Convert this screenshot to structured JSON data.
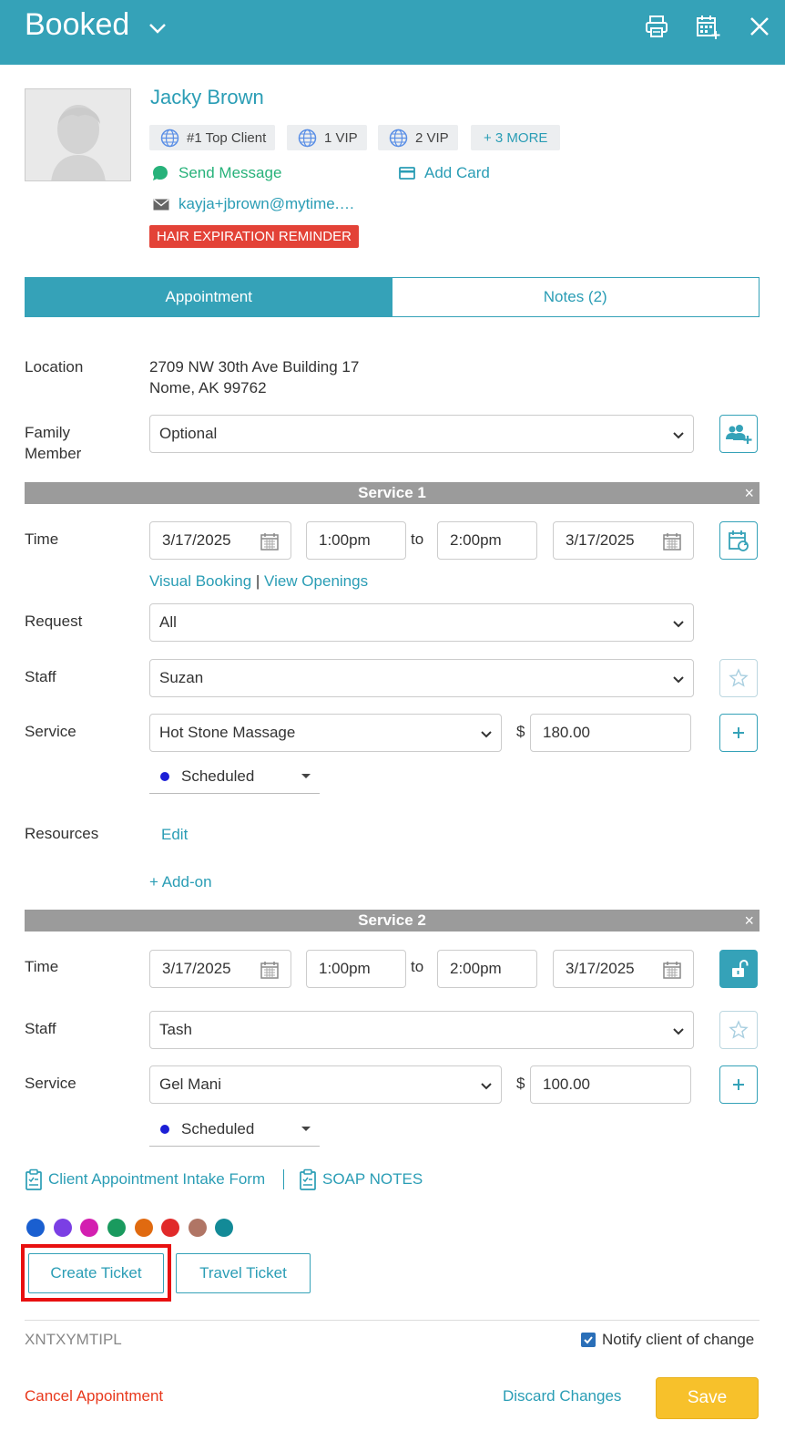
{
  "header": {
    "status_title": "Booked",
    "icons": [
      "print-icon",
      "calendar-add-icon",
      "close-icon"
    ]
  },
  "client": {
    "name": "Jacky Brown",
    "tags": [
      "#1 Top Client",
      "1 VIP",
      "2 VIP"
    ],
    "more_tags": "+ 3 MORE",
    "send_message": "Send Message",
    "add_card": "Add Card",
    "email": "kayja+jbrown@mytime.…",
    "alert": "HAIR EXPIRATION REMINDER"
  },
  "tabs": [
    {
      "label": "Appointment",
      "active": true
    },
    {
      "label": "Notes (2)",
      "active": false
    }
  ],
  "location": {
    "label": "Location",
    "line1": "2709 NW 30th Ave Building 17",
    "line2": "Nome, AK 99762"
  },
  "family_member": {
    "label_line1": "Family",
    "label_line2": "Member",
    "value": "Optional"
  },
  "service1": {
    "header": "Service 1",
    "close": "×",
    "time_label": "Time",
    "start_date": "3/17/2025",
    "start_time": "1:00pm",
    "to": "to",
    "end_time": "2:00pm",
    "end_date": "3/17/2025",
    "visual_booking": "Visual Booking",
    "separator": "|",
    "view_openings": "View Openings",
    "request_label": "Request",
    "request_value": "All",
    "staff_label": "Staff",
    "staff_value": "Suzan",
    "service_label": "Service",
    "service_value": "Hot Stone Massage",
    "currency": "$",
    "price": "180.00",
    "status": "Scheduled",
    "resources_label": "Resources",
    "resources_edit": "Edit",
    "add_on": "+ Add-on"
  },
  "service2": {
    "header": "Service 2",
    "close": "×",
    "time_label": "Time",
    "start_date": "3/17/2025",
    "start_time": "1:00pm",
    "to": "to",
    "end_time": "2:00pm",
    "end_date": "3/17/2025",
    "staff_label": "Staff",
    "staff_value": "Tash",
    "service_label": "Service",
    "service_value": "Gel Mani",
    "currency": "$",
    "price": "100.00",
    "status": "Scheduled"
  },
  "forms": {
    "intake_form": "Client Appointment Intake Form",
    "soap_notes": "SOAP NOTES"
  },
  "colors": [
    "#1a5fd0",
    "#7b3fe4",
    "#d31fb0",
    "#1a9a5e",
    "#e06a10",
    "#e12a2a",
    "#b07565",
    "#138a97"
  ],
  "actions": {
    "create_ticket": "Create Ticket",
    "travel_ticket": "Travel Ticket"
  },
  "footer": {
    "code": "XNTXYMTIPL",
    "notify_label": "Notify client of change",
    "notify_checked": true,
    "cancel": "Cancel Appointment",
    "discard": "Discard Changes",
    "save": "Save"
  }
}
